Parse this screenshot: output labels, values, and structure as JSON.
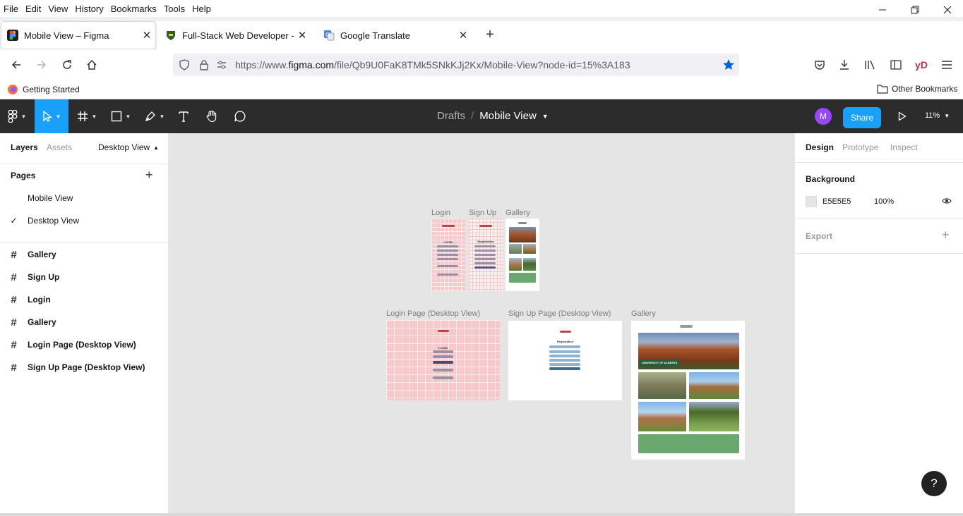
{
  "menu": [
    "File",
    "Edit",
    "View",
    "History",
    "Bookmarks",
    "Tools",
    "Help"
  ],
  "tabs": [
    {
      "title": "Mobile View – Figma",
      "icon": "figma-favicon"
    },
    {
      "title": "Full-Stack Web Developer - UAlberta",
      "icon": "ualberta-shield-favicon"
    },
    {
      "title": "Google Translate",
      "icon": "google-translate-favicon"
    }
  ],
  "url": {
    "prefix": "https://www.",
    "domain": "figma.com",
    "path": "/file/Qb9U0FaK8TMk5SNkKJj2Kx/Mobile-View?node-id=15%3A183"
  },
  "bookmarks": {
    "getting_started": "Getting Started",
    "other": "Other Bookmarks"
  },
  "figma": {
    "breadcrumb_parent": "Drafts",
    "breadcrumb_sep": "/",
    "file_name": "Mobile View",
    "avatar_initial": "M",
    "share": "Share",
    "zoom": "11%",
    "profile_button": "yD"
  },
  "left": {
    "tabs": [
      "Layers",
      "Assets"
    ],
    "page_switcher": "Desktop View",
    "pages_title": "Pages",
    "pages": [
      "Mobile View",
      "Desktop View"
    ],
    "layers": [
      "Gallery",
      "Sign Up",
      "Login",
      "Gallery",
      "Login Page (Desktop View)",
      "Sign Up Page (Desktop View)"
    ]
  },
  "canvas": {
    "frames": [
      {
        "label": "Login",
        "heading": "LOGIN"
      },
      {
        "label": "Sign Up",
        "heading": "Registration"
      },
      {
        "label": "Gallery"
      },
      {
        "label": "Login Page (Desktop View)",
        "heading": "LOGIN"
      },
      {
        "label": "Sign Up Page (Desktop View)",
        "heading": "Registration"
      },
      {
        "label": "Gallery",
        "badge": "UNIVERSITY OF ALBERTA"
      }
    ]
  },
  "right": {
    "tabs": [
      "Design",
      "Prototype",
      "Inspect"
    ],
    "background_title": "Background",
    "bg_hex": "E5E5E5",
    "bg_opacity": "100%",
    "export_title": "Export"
  },
  "help": "?"
}
